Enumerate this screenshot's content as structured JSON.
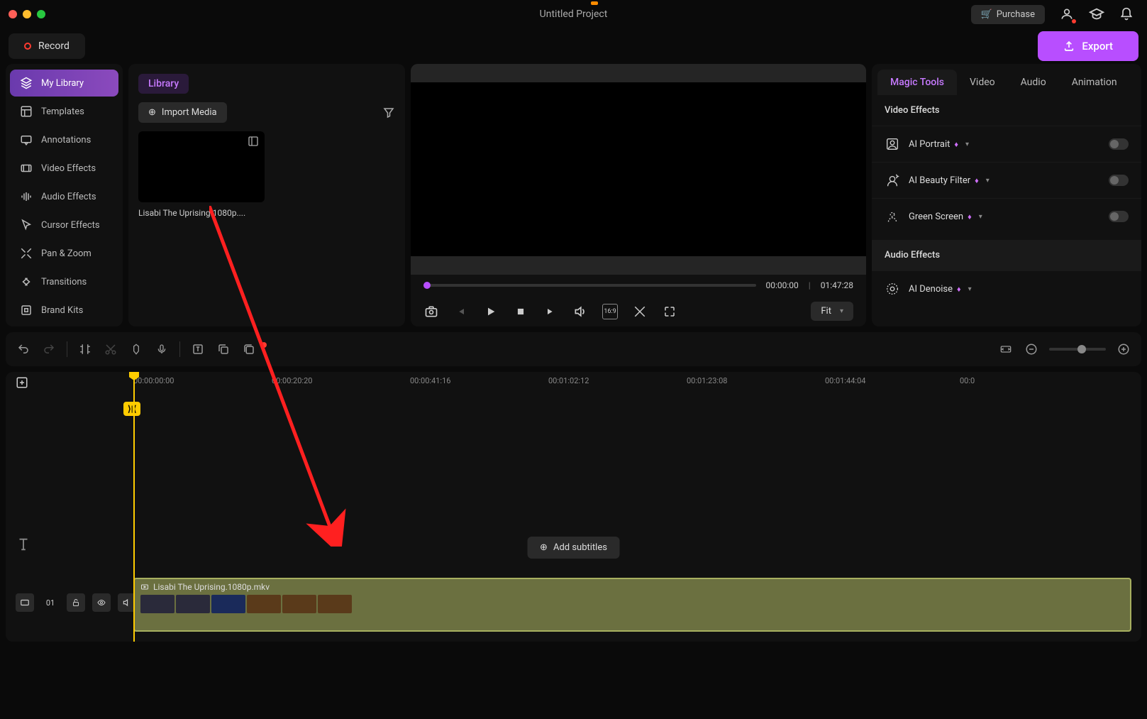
{
  "title": "Untitled Project",
  "header": {
    "purchase": "Purchase",
    "record": "Record",
    "export": "Export"
  },
  "sidebar": {
    "items": [
      {
        "label": "My Library",
        "icon": "layers"
      },
      {
        "label": "Templates",
        "icon": "template"
      },
      {
        "label": "Annotations",
        "icon": "annotation"
      },
      {
        "label": "Video Effects",
        "icon": "video-fx"
      },
      {
        "label": "Audio Effects",
        "icon": "audio-fx"
      },
      {
        "label": "Cursor Effects",
        "icon": "cursor"
      },
      {
        "label": "Pan & Zoom",
        "icon": "pan-zoom"
      },
      {
        "label": "Transitions",
        "icon": "transition"
      },
      {
        "label": "Brand Kits",
        "icon": "brand"
      }
    ]
  },
  "library": {
    "tab": "Library",
    "import": "Import Media",
    "clip_name": "Lisabi The Uprising.1080p...."
  },
  "preview": {
    "current_time": "00:00:00",
    "total_time": "01:47:28",
    "fit_label": "Fit"
  },
  "properties": {
    "tabs": [
      "Magic Tools",
      "Video",
      "Audio",
      "Animation"
    ],
    "section_video": "Video Effects",
    "section_audio": "Audio Effects",
    "effects": [
      {
        "label": "AI Portrait",
        "premium": true
      },
      {
        "label": "AI Beauty Filter",
        "premium": true
      },
      {
        "label": "Green Screen",
        "premium": true
      },
      {
        "label": "AI Denoise",
        "premium": true
      }
    ]
  },
  "timeline": {
    "ruler": [
      "00:00:00:00",
      "00:00:20:20",
      "00:00:41:16",
      "00:01:02:12",
      "00:01:23:08",
      "00:01:44:04",
      "00:0"
    ],
    "add_subtitles": "Add subtitles",
    "clip_name": "Lisabi The Uprising.1080p.mkv",
    "track_num": "01"
  }
}
